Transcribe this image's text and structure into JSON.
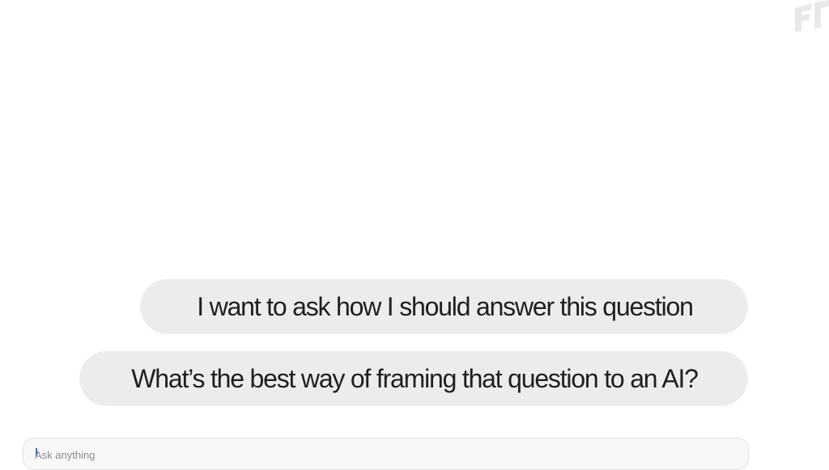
{
  "messages": [
    {
      "role": "user",
      "text": "I want to ask how I should answer this question"
    },
    {
      "role": "user",
      "text": "What’s the best way of framing that question to an AI?"
    }
  ],
  "composer": {
    "placeholder": "Ask anything"
  },
  "icons": {
    "corner": "watermark-logo-icon"
  },
  "colors": {
    "background": "#ffffff",
    "bubble": "#ececec",
    "text": "#1f1f1f",
    "caret": "#2b6de0"
  }
}
